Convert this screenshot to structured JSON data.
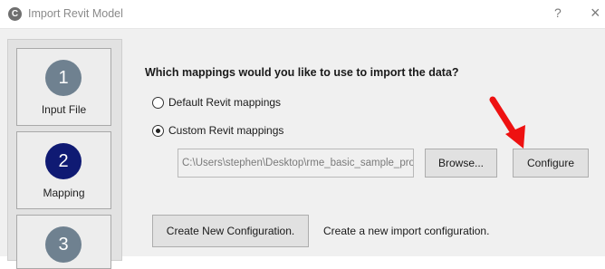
{
  "window": {
    "title": "Import Revit Model",
    "app_icon_glyph": "C",
    "help_glyph": "?",
    "close_glyph": "×"
  },
  "steps": [
    {
      "number": "1",
      "label": "Input File",
      "color": "#6f8190",
      "state": "done"
    },
    {
      "number": "2",
      "label": "Mapping",
      "color": "#0f1a73",
      "state": "current"
    },
    {
      "number": "3",
      "label": "",
      "color": "#6f8190",
      "state": "pending"
    }
  ],
  "main": {
    "question": "Which mappings would you like to use to import the data?",
    "options": [
      {
        "label": "Default Revit mappings",
        "selected": false
      },
      {
        "label": "Custom Revit mappings",
        "selected": true
      }
    ],
    "path_value": "C:\\Users\\stephen\\Desktop\\rme_basic_sample_pro",
    "browse_label": "Browse...",
    "configure_label": "Configure",
    "create_button_label": "Create New Configuration.",
    "create_hint": "Create a new import configuration."
  },
  "annotation": {
    "arrow_color": "#ee1111",
    "arrow_icon": "red-arrow-icon"
  }
}
